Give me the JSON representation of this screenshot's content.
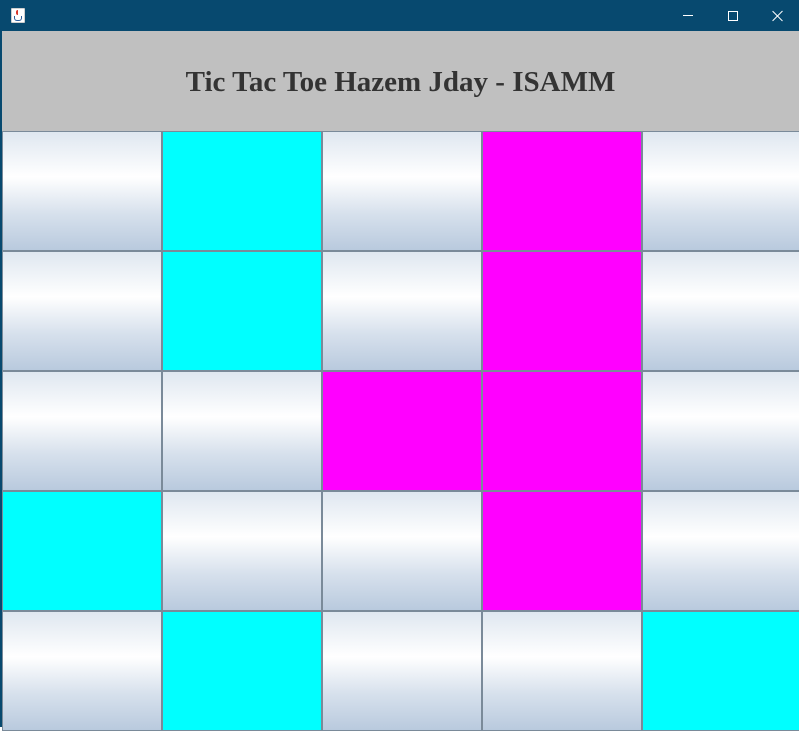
{
  "window": {
    "title": "",
    "colors": {
      "titlebar": "#07496f",
      "header_bg": "#c0c0c0"
    },
    "icons": [
      "java-cup-icon",
      "minimize-icon",
      "maximize-icon",
      "close-icon"
    ]
  },
  "header": {
    "title": "Tic Tac Toe Hazem Jday - ISAMM"
  },
  "board": {
    "rows": 5,
    "cols": 5,
    "colors": {
      "cyan": "#00ffff",
      "magenta": "#ff00ff",
      "empty": "gradient"
    },
    "cells": [
      [
        "empty",
        "cyan",
        "empty",
        "magenta",
        "empty"
      ],
      [
        "empty",
        "cyan",
        "empty",
        "magenta",
        "empty"
      ],
      [
        "empty",
        "empty",
        "magenta",
        "magenta",
        "empty"
      ],
      [
        "cyan",
        "empty",
        "empty",
        "magenta",
        "empty"
      ],
      [
        "empty",
        "cyan",
        "empty",
        "empty",
        "cyan"
      ]
    ]
  }
}
